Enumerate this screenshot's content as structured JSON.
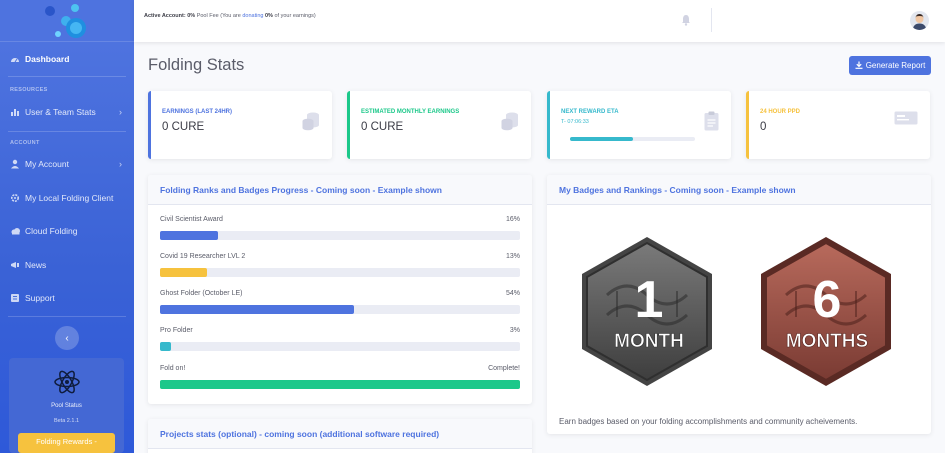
{
  "sidebar": {
    "nav": {
      "dashboard": "Dashboard",
      "resources_heading": "RESOURCES",
      "user_team_stats": "User & Team Stats",
      "account_heading": "ACCOUNT",
      "my_account": "My Account",
      "local_client": "My Local Folding Client",
      "cloud_folding": "Cloud Folding",
      "news": "News",
      "support": "Support"
    },
    "pool_card": {
      "title": "Pool Status",
      "version": "Beta 2.1.1",
      "button_label": "Folding Rewards -"
    }
  },
  "topbar": {
    "account_label": "Active Account:",
    "pool_fee_value": "0%",
    "pool_fee_text": "Pool Fee",
    "donating_prefix": "(You are",
    "donating_word": "donating",
    "donating_value": "0%",
    "donating_suffix": "of your earnings)"
  },
  "main": {
    "page_title": "Folding Stats",
    "generate_button": "Generate Report"
  },
  "stats": [
    {
      "label": "EARNINGS (LAST 24HR)",
      "value": "0 CURE",
      "color": "#4e73df",
      "icon": "coins-icon"
    },
    {
      "label": "ESTIMATED MONTHLY EARNINGS",
      "value": "0 CURE",
      "color": "#1cc88a",
      "icon": "coins-icon"
    },
    {
      "label": "NEXT REWARD ETA",
      "sub": "T- 07:06:33",
      "progress": 0.5,
      "color": "#36b9cc",
      "icon": "clipboard-icon"
    },
    {
      "label": "24 HOUR PPD",
      "value": "0",
      "color": "#f6c23e",
      "icon": "card-icon"
    }
  ],
  "ranks_panel": {
    "title": "Folding Ranks and Badges Progress - Coming soon - Example shown",
    "items": [
      {
        "label": "Civil Scientist Award",
        "percent_text": "16%",
        "percent": 16,
        "color": "#4e73df"
      },
      {
        "label": "Covid 19 Researcher LVL 2",
        "percent_text": "13%",
        "percent": 13,
        "color": "#f6c23e"
      },
      {
        "label": "Ghost Folder (October LE)",
        "percent_text": "54%",
        "percent": 54,
        "color": "#4e73df"
      },
      {
        "label": "Pro Folder",
        "percent_text": "3%",
        "percent": 3,
        "color": "#36b9cc"
      },
      {
        "label": "Fold on!",
        "percent_text": "Complete!",
        "percent": 100,
        "color": "#1cc88a"
      }
    ]
  },
  "badges_panel": {
    "title": "My Badges and Rankings - Coming soon - Example shown",
    "badge1": {
      "number": "1",
      "word": "MONTH"
    },
    "badge2": {
      "number": "6",
      "word": "MONTHS"
    },
    "note": "Earn badges based on your folding accomplishments and community acheivements."
  },
  "projects_panel": {
    "title": "Projects stats (optional) - coming soon (additional software required)"
  }
}
